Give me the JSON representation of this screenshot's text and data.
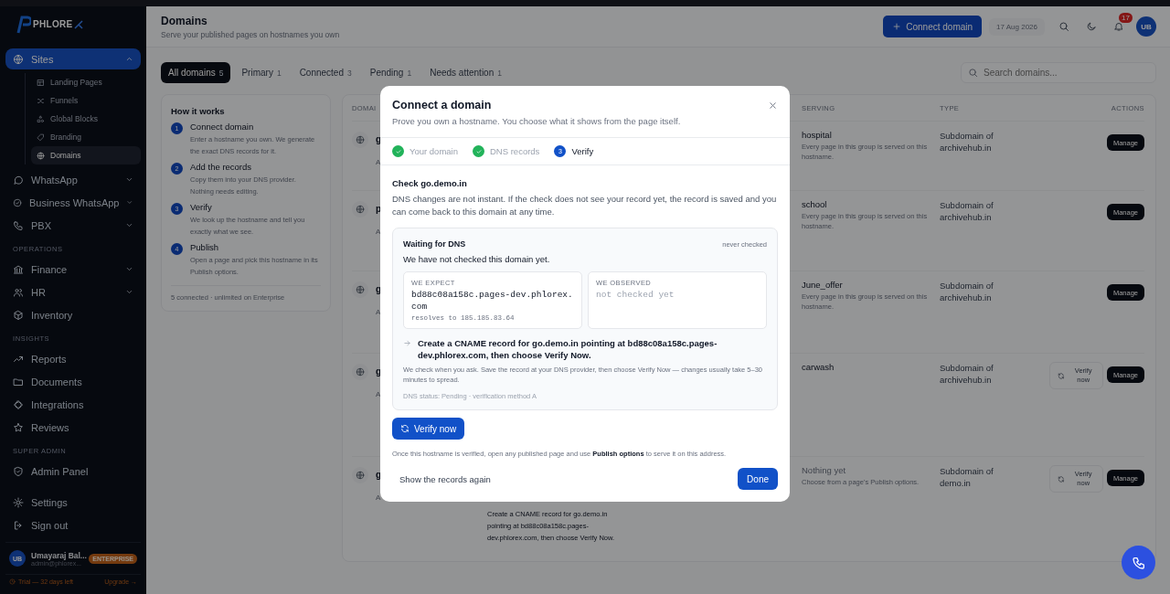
{
  "sidebar": {
    "logo": "PHLORE",
    "nav": [
      {
        "kind": "item",
        "label": "Sites",
        "selected": true,
        "expanded": true,
        "children": [
          {
            "label": "Landing Pages",
            "selected": false
          },
          {
            "label": "Funnels",
            "selected": false
          },
          {
            "label": "Global Blocks",
            "selected": false
          },
          {
            "label": "Branding",
            "selected": false
          },
          {
            "label": "Domains",
            "selected": true
          }
        ]
      },
      {
        "kind": "item",
        "label": "WhatsApp",
        "selected": false,
        "expanded": false
      },
      {
        "kind": "item",
        "label": "Business WhatsApp",
        "selected": false,
        "expanded": false
      },
      {
        "kind": "item",
        "label": "PBX",
        "selected": false,
        "expanded": false
      },
      {
        "kind": "heading",
        "label": "OPERATIONS"
      },
      {
        "kind": "item",
        "label": "Finance",
        "selected": false,
        "expanded": false
      },
      {
        "kind": "item",
        "label": "HR",
        "selected": false,
        "expanded": false
      },
      {
        "kind": "item",
        "label": "Inventory",
        "selected": false
      },
      {
        "kind": "heading",
        "label": "INSIGHTS"
      },
      {
        "kind": "item",
        "label": "Reports",
        "selected": false
      },
      {
        "kind": "item",
        "label": "Documents",
        "selected": false
      },
      {
        "kind": "item",
        "label": "Integrations",
        "selected": false
      },
      {
        "kind": "item",
        "label": "Reviews",
        "selected": false
      },
      {
        "kind": "heading",
        "label": "SUPER ADMIN"
      },
      {
        "kind": "item",
        "label": "Admin Panel",
        "selected": false
      }
    ],
    "footer_items": [
      "Settings",
      "Sign out"
    ],
    "user": {
      "initials": "UB",
      "name": "Umayaraj Bal...",
      "email": "admin@phlorex...",
      "plan": "ENTERPRISE"
    },
    "trial": {
      "text": "Trial — 32 days left",
      "link": "Upgrade →"
    }
  },
  "header": {
    "title": "Domains",
    "subtitle": "Serve your published pages on hostnames you own",
    "primary_button": "Connect domain",
    "date": "17 Aug 2026",
    "notifications": "17",
    "avatar": "UB"
  },
  "tabs": [
    {
      "label": "All domains",
      "count": "5",
      "selected": true
    },
    {
      "label": "Primary",
      "count": "1",
      "selected": false
    },
    {
      "label": "Connected",
      "count": "3",
      "selected": false
    },
    {
      "label": "Pending",
      "count": "1",
      "selected": false
    },
    {
      "label": "Needs attention",
      "count": "1",
      "selected": false
    }
  ],
  "search": {
    "placeholder": "Search domains..."
  },
  "how_it_works": {
    "title": "How it works",
    "steps": [
      {
        "number": "1",
        "title": "Connect domain",
        "text": "Enter a hostname you own. We generate the exact DNS records for it."
      },
      {
        "number": "2",
        "title": "Add the records",
        "text": "Copy them into your DNS provider. Nothing needs editing."
      },
      {
        "number": "3",
        "title": "Verify",
        "text": "We look up the hostname and tell you exactly what we see."
      },
      {
        "number": "4",
        "title": "Publish",
        "text": "Open a page and pick this hostname in its Publish options."
      }
    ],
    "footer": "5 connected · unlimited on Enterprise"
  },
  "table": {
    "columns": [
      "DOMAI",
      "SERVING",
      "TYPE",
      "ACTIONS"
    ],
    "rows": [
      {
        "domain": "g",
        "note": "A",
        "serving": "hospital",
        "serving_note": "Every page in this group is served on this hostname.",
        "assigned": true,
        "type": "Subdomain of archivehub.in",
        "actions": [
          "Manage"
        ]
      },
      {
        "domain": "p",
        "note": "A",
        "serving": "school",
        "serving_note": "Every page in this group is served on this hostname.",
        "assigned": true,
        "type": "Subdomain of archivehub.in",
        "actions": [
          "Manage"
        ]
      },
      {
        "domain": "g",
        "note": "A",
        "serving": "June_offer",
        "serving_note": "Every page in this group is served on this hostname.",
        "assigned": true,
        "type": "Subdomain of archivehub.in",
        "actions": [
          "Manage"
        ]
      },
      {
        "domain": "g",
        "note": "A",
        "serving": "carwash",
        "assigned": true,
        "type": "Subdomain of archivehub.in",
        "verify": "Verify now",
        "actions": [
          "Manage"
        ]
      },
      {
        "domain": "g",
        "note": "A",
        "status_note": "Create a CNAME record for go.demo.in pointing at bd88c08a158c.pages-dev.phlorex.com, then choose Verify Now.",
        "serving": "Nothing yet",
        "serving_note": "Choose from a page's Publish options.",
        "assigned": false,
        "type": "Subdomain of demo.in",
        "verify": "Verify now",
        "actions": [
          "Manage"
        ]
      }
    ]
  },
  "modal": {
    "title": "Connect a domain",
    "subtitle": "Prove you own a hostname. You choose what it shows from the page itself.",
    "steps": [
      {
        "label": "Your domain",
        "done": true,
        "selected": false
      },
      {
        "label": "DNS records",
        "done": true,
        "selected": false
      },
      {
        "label": "Verify",
        "number": "3",
        "done": false,
        "selected": true
      }
    ],
    "check_title": "Check go.demo.in",
    "check_text": "DNS changes are not instant. If the check does not see your record yet, the record is saved and you can come back to this domain at any time.",
    "status": {
      "title": "Waiting for DNS",
      "last_checked": "never checked",
      "text": "We have not checked this domain yet.",
      "expect": {
        "label": "WE EXPECT",
        "value": "bd88c08a158c.pages-dev.phlorex.com",
        "resolves": "resolves to 185.185.83.64"
      },
      "observed": {
        "label": "WE OBSERVED",
        "value": "not checked yet"
      },
      "instruction": "Create a CNAME record for go.demo.in pointing at bd88c08a158c.pages-dev.phlorex.com, then choose Verify Now.",
      "note": "We check when you ask. Save the record at your DNS provider, then choose Verify Now — changes usually take 5–30 minutes to spread.",
      "dns_status": "DNS status: Pending · verification method A"
    },
    "verify_button": "Verify now",
    "publish_note": "Once this hostname is verified, open any published page and use **Publish options** to serve it on this address.",
    "secondary_button": "Show the records again",
    "primary_button": "Done"
  }
}
